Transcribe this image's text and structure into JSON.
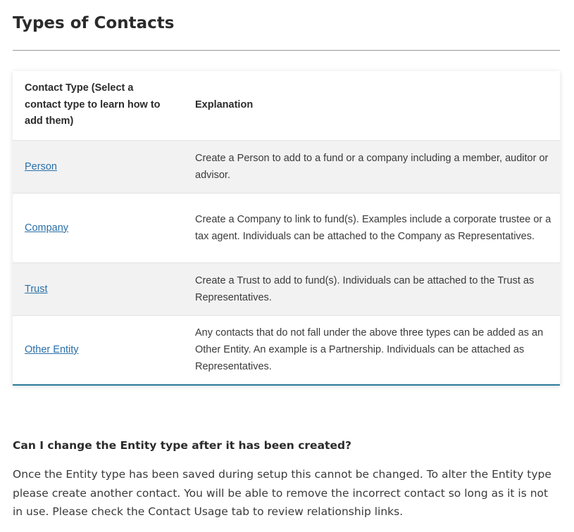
{
  "page": {
    "title": "Types of Contacts"
  },
  "table": {
    "headers": {
      "contact_type": "Contact Type (Select a contact type to learn how to add them)",
      "explanation": "Explanation"
    },
    "rows": [
      {
        "type": "Person",
        "explanation": "Create a Person to add to a fund or a company including a member, auditor or advisor."
      },
      {
        "type": "Company",
        "explanation": "Create a Company to link to fund(s). Examples include a corporate trustee or a tax agent. Individuals can be attached to the Company as Representatives."
      },
      {
        "type": "Trust",
        "explanation": "Create a Trust to add to fund(s). Individuals can be attached to the Trust as Representatives."
      },
      {
        "type": "Other Entity",
        "explanation": "Any contacts that do not fall under the above three types can be added as an Other Entity. An example is a Partnership. Individuals can be attached as Representatives."
      }
    ]
  },
  "faq": {
    "question": "Can I change the Entity type after it has been created?",
    "answer": "Once the Entity type has been saved during setup this cannot be changed. To alter the Entity type please create another contact. You will be able to remove the incorrect contact so long as it is not in use. Please check the Contact Usage tab to review relationship links."
  },
  "colors": {
    "link": "#2a6fa8",
    "table_accent_border": "#2b7a9a",
    "shaded_row": "#f2f2f2",
    "divider": "#9a9a9a"
  }
}
